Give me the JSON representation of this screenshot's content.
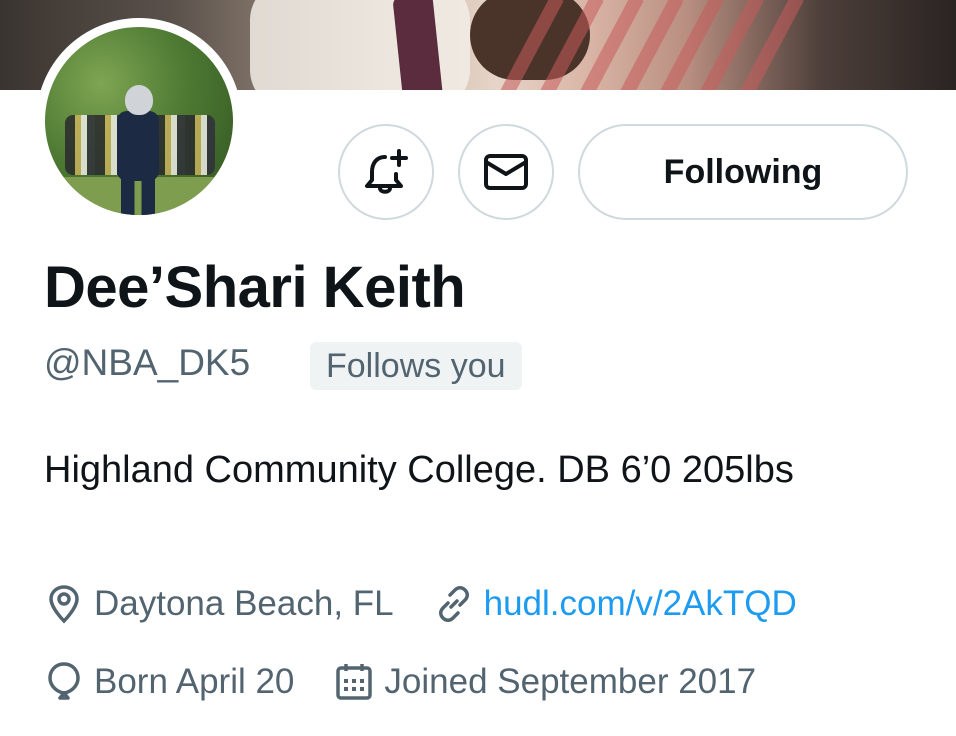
{
  "profile": {
    "name": "Dee’Shari Keith",
    "handle": "@NBA_DK5",
    "follows_you": "Follows you",
    "bio": "Highland Community College. DB 6’0 205lbs",
    "location": "Daytona Beach, FL",
    "website": "hudl.com/v/2AkTQD",
    "birthday": "Born April 20",
    "joined": "Joined September 2017"
  },
  "actions": {
    "notify_icon": "bell-plus-icon",
    "message_icon": "envelope-icon",
    "following_label": "Following"
  },
  "colors": {
    "text": "#0f1419",
    "secondary": "#536471",
    "link": "#1d9bf0",
    "border": "#cfd9de",
    "badge_bg": "#eff3f4"
  }
}
